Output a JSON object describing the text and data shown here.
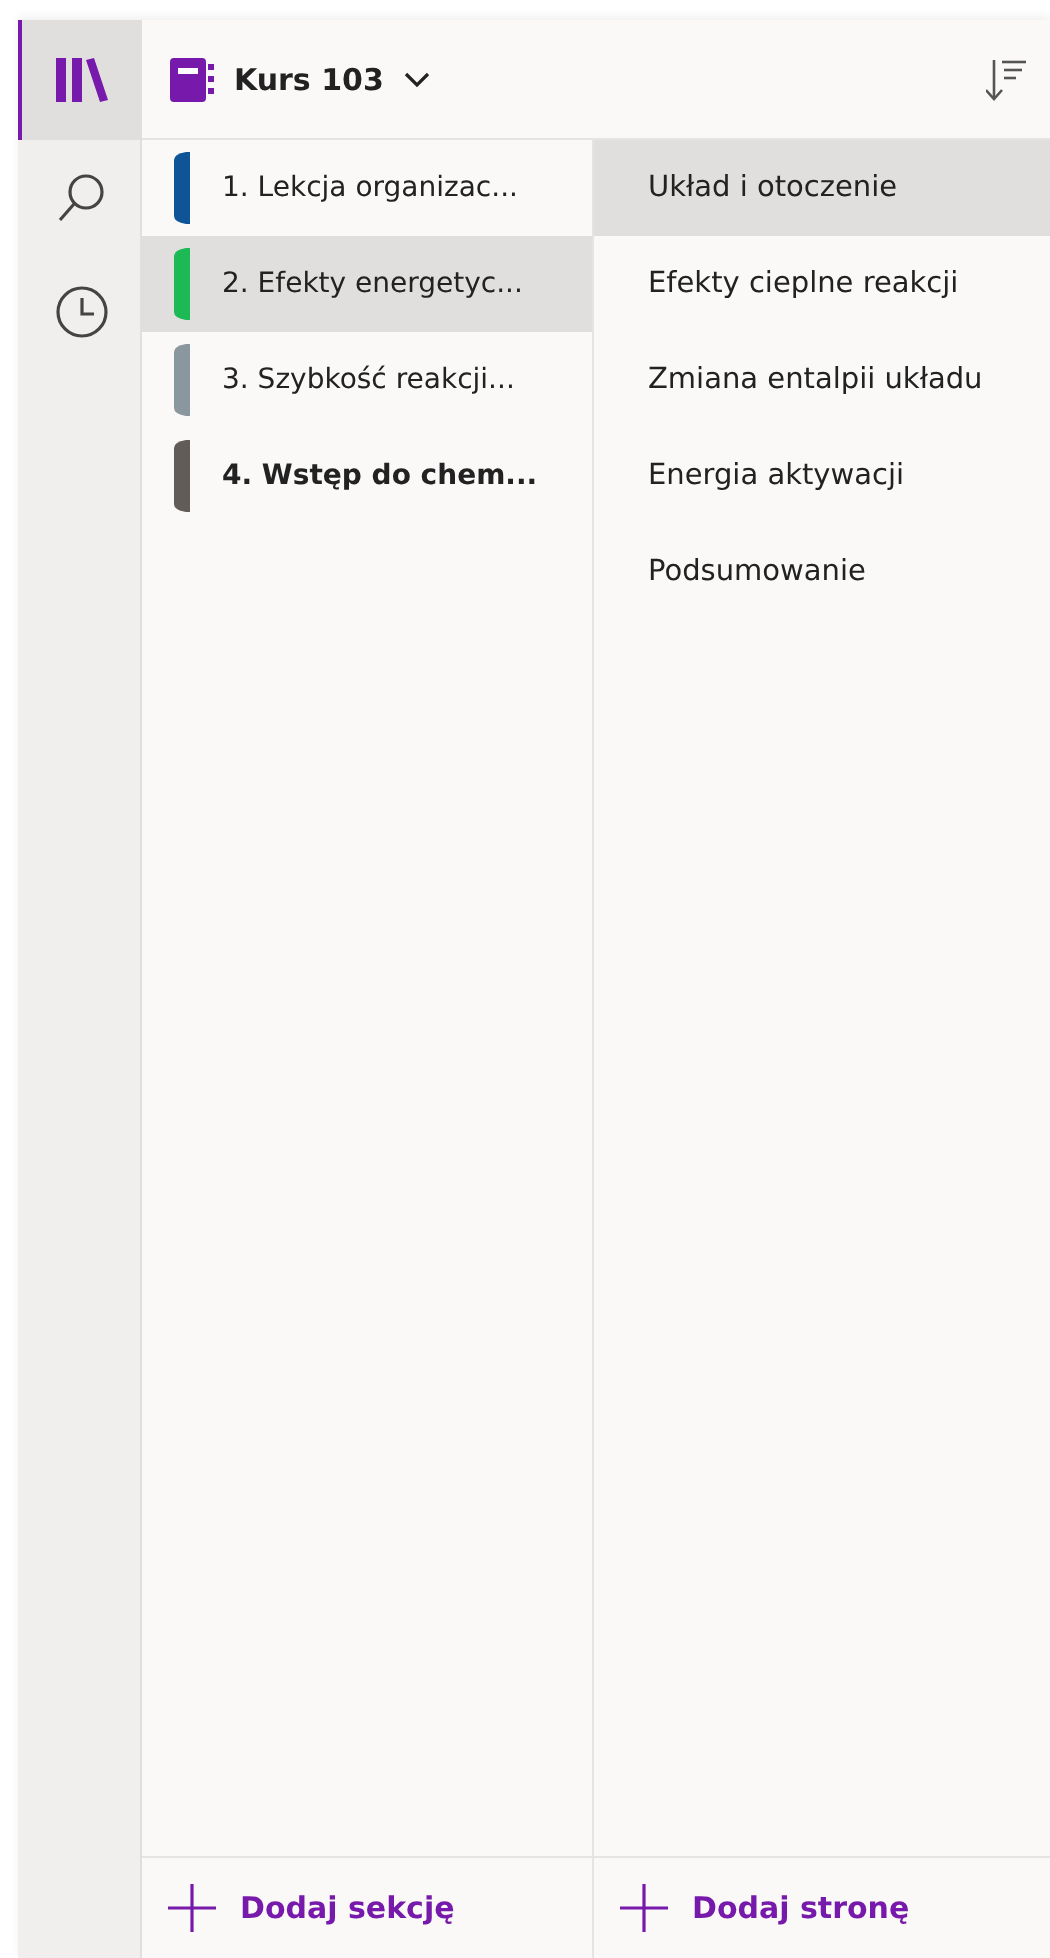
{
  "rail": [
    {
      "kind": "notebooks",
      "selected": true
    },
    {
      "kind": "search",
      "selected": false
    },
    {
      "kind": "recent",
      "selected": false
    }
  ],
  "notebook": {
    "title": "Kurs 103"
  },
  "sections": [
    {
      "label": "1. Lekcja organizac...",
      "color": "#0f5496",
      "selected": false,
      "unread": false
    },
    {
      "label": "2. Efekty energetyc...",
      "color": "#1db954",
      "selected": true,
      "unread": false
    },
    {
      "label": "3. Szybkość reakcji...",
      "color": "#8b979e",
      "selected": false,
      "unread": false
    },
    {
      "label": "4. Wstęp do chem...",
      "color": "#625c58",
      "selected": false,
      "unread": true
    }
  ],
  "pages": [
    {
      "label": "Układ i otoczenie",
      "selected": true
    },
    {
      "label": "Efekty cieplne reakcji",
      "selected": false
    },
    {
      "label": "Zmiana entalpii układu",
      "selected": false
    },
    {
      "label": "Energia aktywacji",
      "selected": false
    },
    {
      "label": "Podsumowanie",
      "selected": false
    }
  ],
  "add_section": "Dodaj sekcję",
  "add_page": "Dodaj stronę"
}
